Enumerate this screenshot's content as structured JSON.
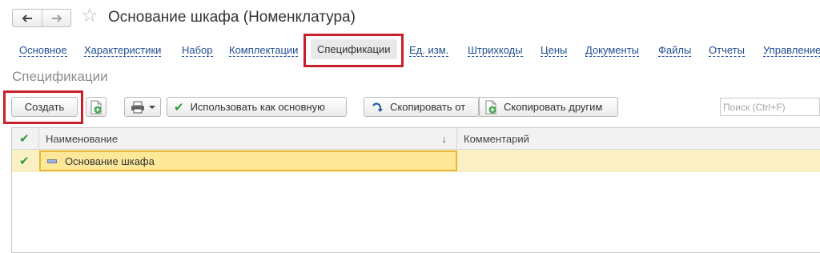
{
  "window": {
    "title": "Основание шкафа (Номенклатура)",
    "back_icon": "arrow-left-icon",
    "forward_icon": "arrow-right-icon",
    "favorite_icon": "star-icon"
  },
  "tabs": [
    {
      "label": "Основное"
    },
    {
      "label": "Характеристики"
    },
    {
      "label": "Набор"
    },
    {
      "label": "Комплектации"
    },
    {
      "label": "Спецификации",
      "active": true
    },
    {
      "label": "Ед. изм."
    },
    {
      "label": "Штрихкоды"
    },
    {
      "label": "Цены"
    },
    {
      "label": "Документы"
    },
    {
      "label": "Файлы"
    },
    {
      "label": "Отчеты"
    },
    {
      "label": "Управление"
    }
  ],
  "section_title": "Спецификации",
  "toolbar": {
    "create_label": "Создать",
    "use_main_label": "Использовать как основную",
    "copy_from_label": "Скопировать от",
    "copy_to_others_label": "Скопировать другим"
  },
  "search": {
    "placeholder": "Поиск (Ctrl+F)"
  },
  "table": {
    "columns": [
      {
        "label": "Наименование",
        "sort_icon": "↓"
      },
      {
        "label": "Комментарий"
      }
    ],
    "rows": [
      {
        "name": "Основание шкафа",
        "comment": "",
        "main": true
      }
    ]
  },
  "colors": {
    "link": "#1f4e91",
    "highlight_frame": "#c8202c",
    "selected_row": "#fbf0c4",
    "selected_cell": "#fde89a",
    "check_green": "#2e9a3c"
  }
}
